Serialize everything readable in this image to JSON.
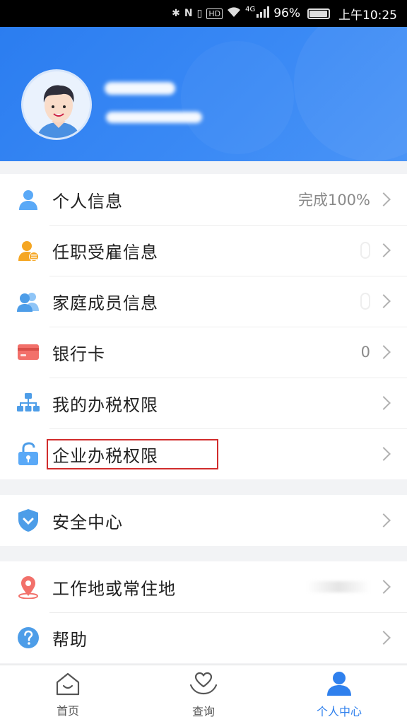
{
  "status_bar": {
    "battery": "96%",
    "time": "上午10:25",
    "network": "4G",
    "icons": [
      "bluetooth-icon",
      "nfc-icon",
      "vibrate-icon",
      "hd-icon",
      "wifi-icon",
      "signal-icon",
      "battery-icon"
    ]
  },
  "header": {
    "background_color": "#2f80ed",
    "avatar_icon": "avatar-cartoon-man"
  },
  "sections": [
    {
      "items": [
        {
          "label": "个人信息",
          "value": "完成100%",
          "icon": "person-icon"
        },
        {
          "label": "任职受雇信息",
          "value": "",
          "icon": "employment-icon"
        },
        {
          "label": "家庭成员信息",
          "value": "",
          "icon": "family-icon"
        },
        {
          "label": "银行卡",
          "value": "0",
          "icon": "bank-card-icon"
        },
        {
          "label": "我的办税权限",
          "value": "",
          "icon": "org-tree-icon"
        },
        {
          "label": "企业办税权限",
          "value": "",
          "icon": "lock-icon",
          "highlighted": true
        }
      ]
    },
    {
      "items": [
        {
          "label": "安全中心",
          "value": "",
          "icon": "shield-icon"
        }
      ]
    },
    {
      "items": [
        {
          "label": "工作地或常住地",
          "value": "",
          "icon": "location-pin-icon"
        },
        {
          "label": "帮助",
          "value": "",
          "icon": "help-icon"
        }
      ]
    }
  ],
  "tabbar": {
    "tabs": [
      {
        "label": "首页",
        "icon": "home-icon",
        "active": false
      },
      {
        "label": "查询",
        "icon": "heart-hand-icon",
        "active": false
      },
      {
        "label": "个人中心",
        "icon": "person-filled-icon",
        "active": true
      }
    ],
    "active_color": "#2f80ed"
  },
  "highlight_color": "#d12c2c"
}
